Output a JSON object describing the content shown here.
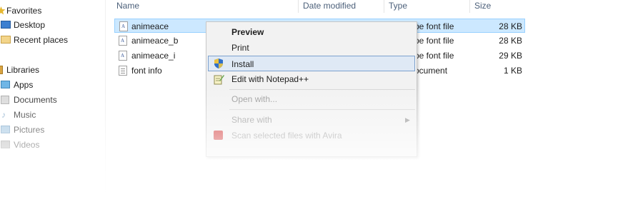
{
  "nav": {
    "items": [
      {
        "label": "Favorites"
      },
      {
        "label": "Desktop"
      },
      {
        "label": "Recent places"
      },
      {
        "label": "Libraries"
      },
      {
        "label": "Apps"
      },
      {
        "label": "Documents"
      },
      {
        "label": "Music"
      },
      {
        "label": "Pictures"
      },
      {
        "label": "Videos"
      }
    ]
  },
  "columns": {
    "name": "Name",
    "date_modified": "Date modified",
    "type": "Type",
    "size": "Size"
  },
  "files": [
    {
      "name": "animeace",
      "type": "pe font file",
      "size": "28 KB"
    },
    {
      "name": "animeace_b",
      "type": "pe font file",
      "size": "28 KB"
    },
    {
      "name": "animeace_i",
      "type": "pe font file",
      "size": "29 KB"
    },
    {
      "name": "font info",
      "type": "ocument",
      "size": "1 KB"
    }
  ],
  "context_menu": {
    "items": [
      {
        "label": "Preview"
      },
      {
        "label": "Print"
      },
      {
        "label": "Install"
      },
      {
        "label": "Edit with Notepad++"
      },
      {
        "label": "Open with..."
      },
      {
        "label": "Share with"
      },
      {
        "label": "Scan selected files with Avira"
      }
    ]
  }
}
